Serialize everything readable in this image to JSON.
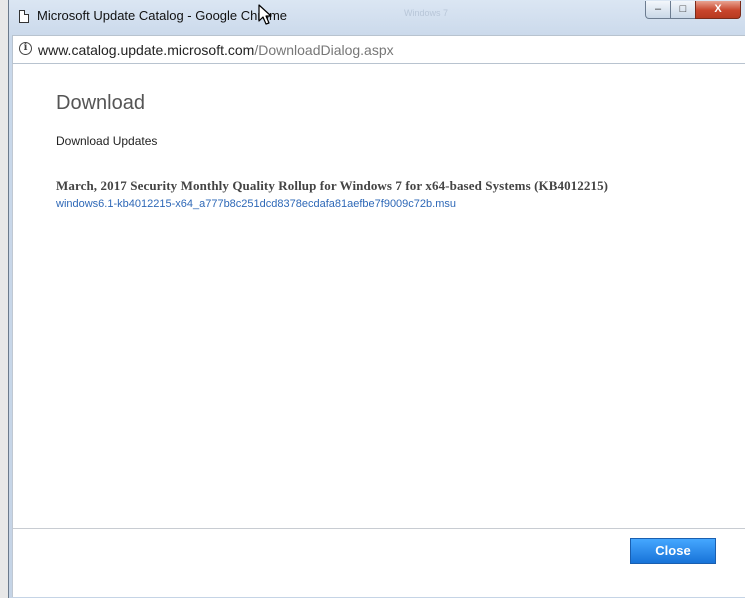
{
  "window": {
    "title": "Microsoft Update Catalog - Google Chrome",
    "background_title": "Windows 7",
    "controls": {
      "minimize": "–",
      "maximize": "□",
      "close": "X"
    }
  },
  "address": {
    "host": "www.catalog.update.microsoft.com",
    "path": "/DownloadDialog.aspx",
    "info_icon": "i"
  },
  "dialog": {
    "heading": "Download",
    "subtitle": "Download Updates",
    "update_title": "March, 2017 Security Monthly Quality Rollup for Windows 7 for x64-based Systems (KB4012215)",
    "update_file": "windows6.1-kb4012215-x64_a777b8c251dcd8378ecdafa81aefbe7f9009c72b.msu",
    "close_label": "Close"
  },
  "colors": {
    "link": "#2e68b7",
    "button": "#1873d8"
  }
}
